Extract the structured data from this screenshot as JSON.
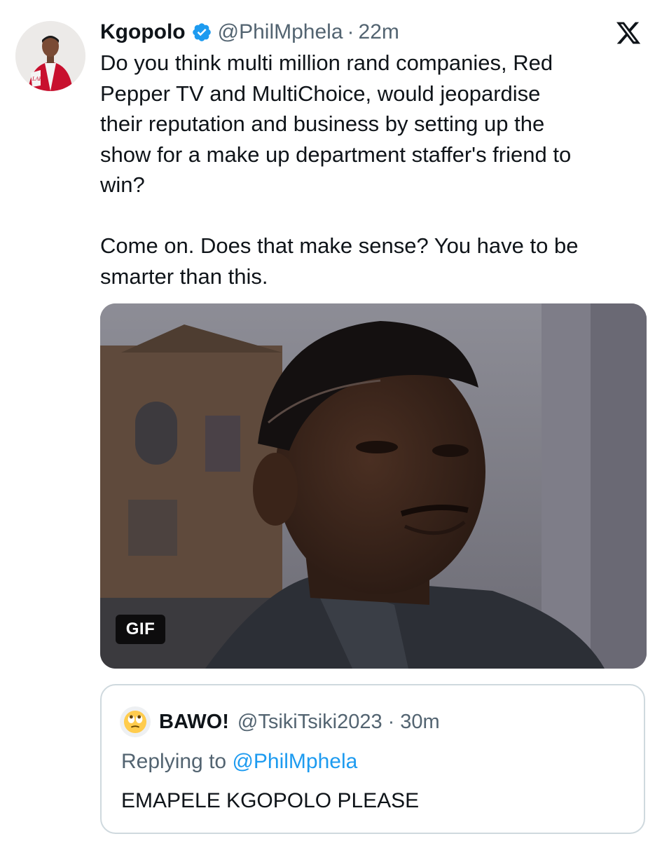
{
  "tweet": {
    "author_name": "Kgopolo",
    "author_handle": "@PhilMphela",
    "separator": "·",
    "time": "22m",
    "text": "Do you think multi million rand companies, Red\nPepper TV and MultiChoice, would jeopardise\ntheir reputation and business by setting up the\nshow for a make up department staffer's friend to\nwin?\n\nCome on. Does that make sense? You have to be\nsmarter than this.",
    "media": {
      "badge": "GIF"
    }
  },
  "quoted_tweet": {
    "author_name": "BAWO!",
    "author_handle": "@TsikiTsiki2023",
    "separator": "·",
    "time": "30m",
    "replying_prefix": "Replying to ",
    "replying_to": "@PhilMphela",
    "text": "EMAPELE KGOPOLO PLEASE"
  },
  "icons": {
    "verified": "verified-badge-icon",
    "brand": "x-logo-icon",
    "quoted_avatar": "rolling-eyes-emoji-icon"
  },
  "colors": {
    "text_primary": "#0f1419",
    "text_secondary": "#536471",
    "verified_blue": "#1d9bf0",
    "link_blue": "#1d9bf0",
    "quote_border": "#cfd9de",
    "jacket_red": "#c8102e"
  }
}
